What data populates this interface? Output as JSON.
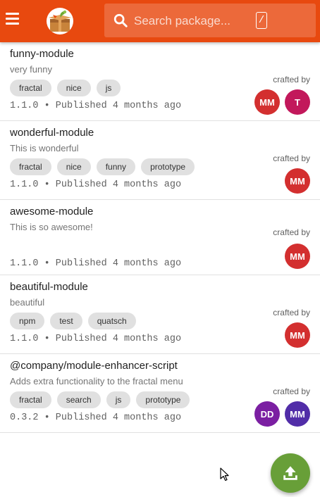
{
  "header": {
    "menu_icon": "menu-icon",
    "logo_icon": "package-box-logo",
    "search_placeholder": "Search package...",
    "search_shortcut": "/",
    "brand_color": "#e8490f"
  },
  "packages": [
    {
      "name": "funny-module",
      "description": "very funny",
      "tags": [
        "fractal",
        "nice",
        "js"
      ],
      "meta": "1.1.0 • Published 4 months ago",
      "crafted_label": "crafted by",
      "authors": [
        {
          "initials": "MM",
          "color": "#d32f2f"
        },
        {
          "initials": "T",
          "color": "#c2185b"
        }
      ]
    },
    {
      "name": "wonderful-module",
      "description": "This is wonderful",
      "tags": [
        "fractal",
        "nice",
        "funny",
        "prototype"
      ],
      "meta": "1.1.0 • Published 4 months ago",
      "crafted_label": "crafted by",
      "authors": [
        {
          "initials": "MM",
          "color": "#d32f2f"
        }
      ]
    },
    {
      "name": "awesome-module",
      "description": "This is so awesome!",
      "tags": [],
      "meta": "1.1.0 • Published 4 months ago",
      "crafted_label": "crafted by",
      "authors": [
        {
          "initials": "MM",
          "color": "#d32f2f"
        }
      ]
    },
    {
      "name": "beautiful-module",
      "description": "beautiful",
      "tags": [
        "npm",
        "test",
        "quatsch"
      ],
      "meta": "1.1.0 • Published 4 months ago",
      "crafted_label": "crafted by",
      "authors": [
        {
          "initials": "MM",
          "color": "#d32f2f"
        }
      ]
    },
    {
      "name": "@company/module-enhancer-script",
      "description": "Adds extra functionality to the fractal menu",
      "tags": [
        "fractal",
        "search",
        "js",
        "prototype"
      ],
      "meta": "0.3.2 • Published 4 months ago",
      "crafted_label": "crafted by",
      "authors": [
        {
          "initials": "DD",
          "color": "#7b1fa2"
        },
        {
          "initials": "MM",
          "color": "#512da8"
        }
      ]
    }
  ],
  "fab": {
    "icon": "upload-icon",
    "color": "#689f38"
  }
}
